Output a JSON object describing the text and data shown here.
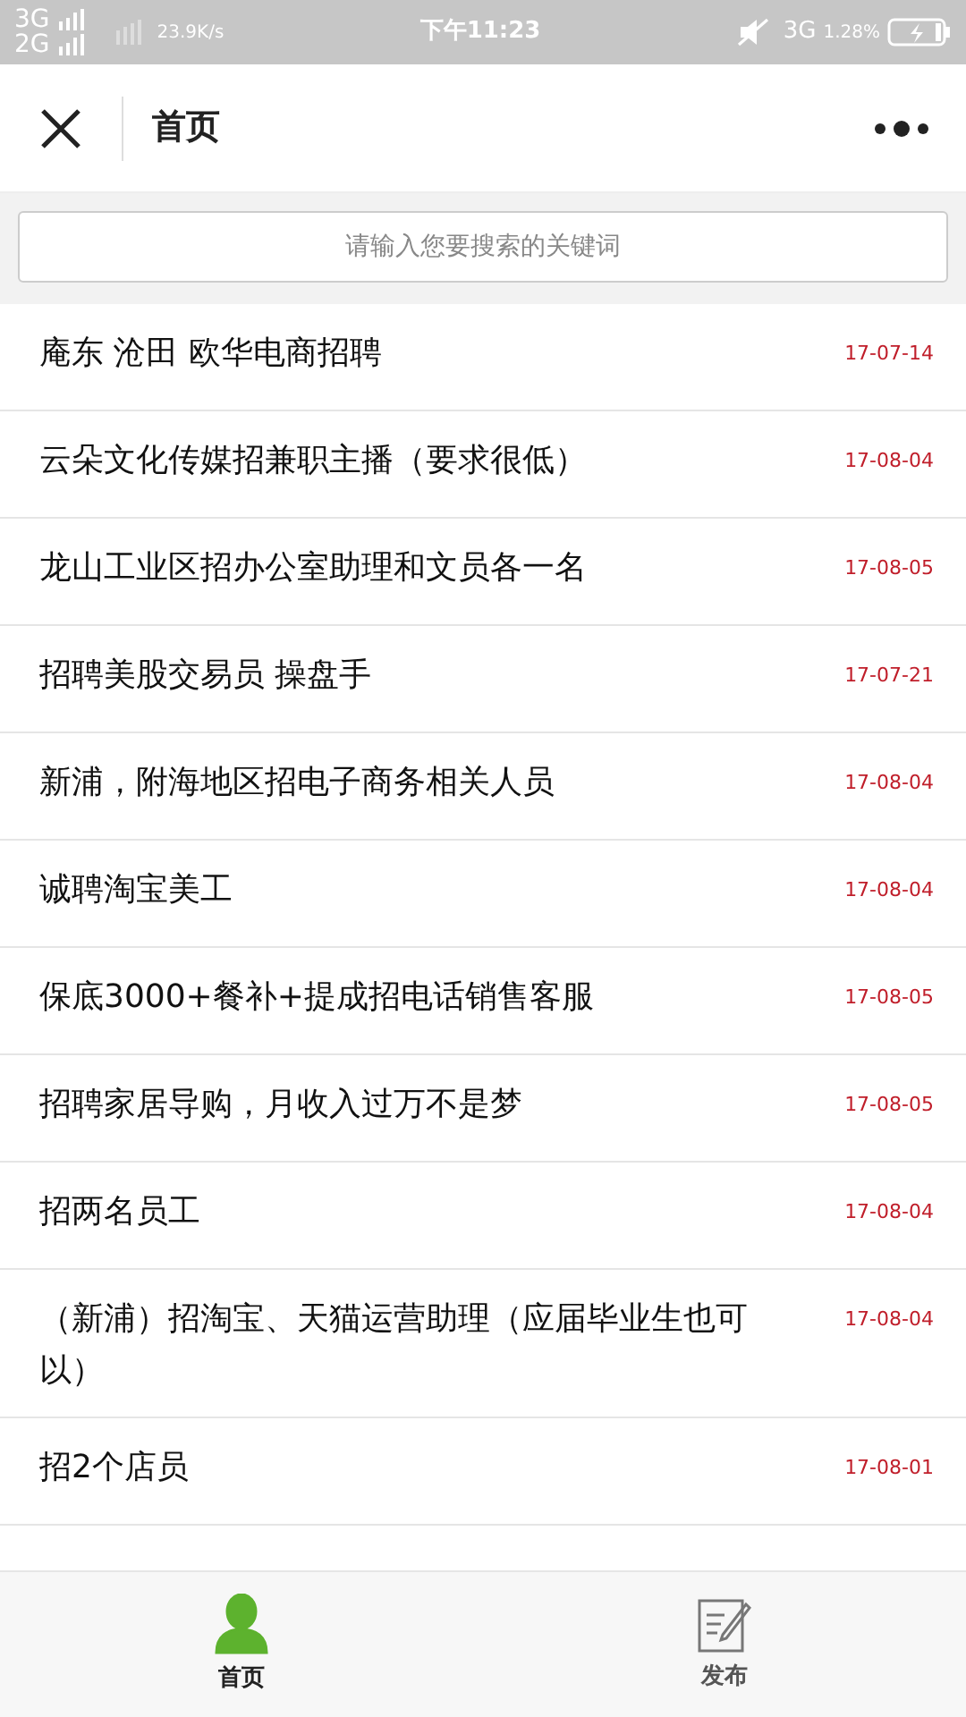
{
  "status_bar": {
    "networks": [
      "3G",
      "2G"
    ],
    "speed": "23.9K/s",
    "time": "下午11:23",
    "network_right": "3G",
    "percent": "1.28%"
  },
  "header": {
    "title": "首页"
  },
  "search": {
    "placeholder": "请输入您要搜索的关键词"
  },
  "posts": [
    {
      "title": "庵东 沧田 欧华电商招聘",
      "date": "17-07-14"
    },
    {
      "title": "云朵文化传媒招兼职主播（要求很低）",
      "date": "17-08-04"
    },
    {
      "title": "龙山工业区招办公室助理和文员各一名",
      "date": "17-08-05"
    },
    {
      "title": "招聘美股交易员 操盘手",
      "date": "17-07-21"
    },
    {
      "title": "新浦，附海地区招电子商务相关人员",
      "date": "17-08-04"
    },
    {
      "title": "诚聘淘宝美工",
      "date": "17-08-04"
    },
    {
      "title": "保底3000+餐补+提成招电话销售客服",
      "date": "17-08-05"
    },
    {
      "title": "招聘家居导购，月收入过万不是梦",
      "date": "17-08-05"
    },
    {
      "title": "招两名员工",
      "date": "17-08-04"
    },
    {
      "title": "（新浦）招淘宝、天猫运营助理（应届毕业生也可以）",
      "date": "17-08-04"
    },
    {
      "title": "招2个店员",
      "date": "17-08-01"
    }
  ],
  "tabs": [
    {
      "label": "首页",
      "kind": "person",
      "selected": true
    },
    {
      "label": "发布",
      "kind": "edit",
      "selected": false
    }
  ]
}
